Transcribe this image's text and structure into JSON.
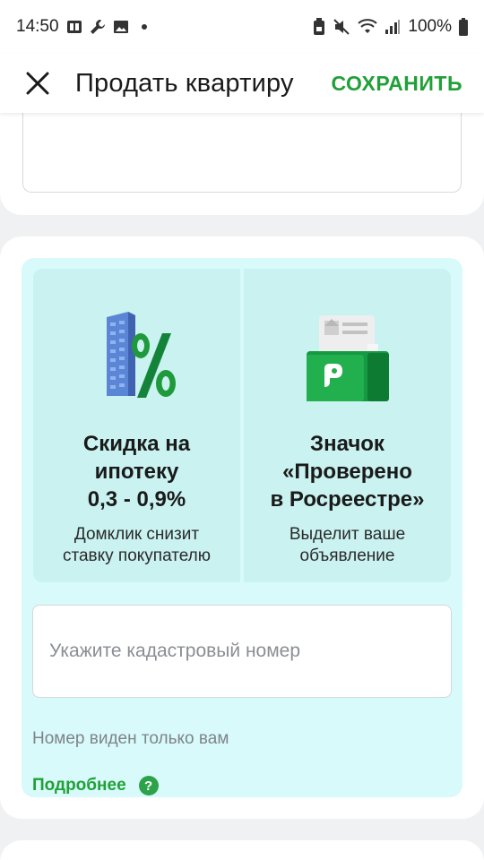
{
  "status_bar": {
    "time": "14:50",
    "battery": "100%",
    "left_icons": [
      "app-icon",
      "wrench-icon",
      "image-icon",
      "dot-icon"
    ],
    "right_icons": [
      "lock-battery-icon",
      "mute-icon",
      "wifi-icon",
      "signal-icon",
      "battery-icon"
    ]
  },
  "app_bar": {
    "title": "Продать квартиру",
    "save_label": "СОХРАНИТЬ",
    "close_icon": "close-icon"
  },
  "promo": {
    "features": [
      {
        "title": "Скидка на\nипотеку\n0,3 - 0,9%",
        "description": "Домклик снизит\nставку покупателю",
        "illustration": "building-percent-illustration"
      },
      {
        "title": "Значок\n«Проверено\nв Росреестре»",
        "description": "Выделит ваше\nобъявление",
        "illustration": "verified-folder-illustration"
      }
    ],
    "cadastral_input": {
      "placeholder": "Укажите кадастровый номер",
      "value": ""
    },
    "helper_text": "Номер виден только вам",
    "more_link": "Подробнее",
    "help_icon": "?"
  },
  "colors": {
    "accent_green": "#21a038",
    "promo_bg": "#d8fafa",
    "feature_bg": "#c9f2f1"
  }
}
